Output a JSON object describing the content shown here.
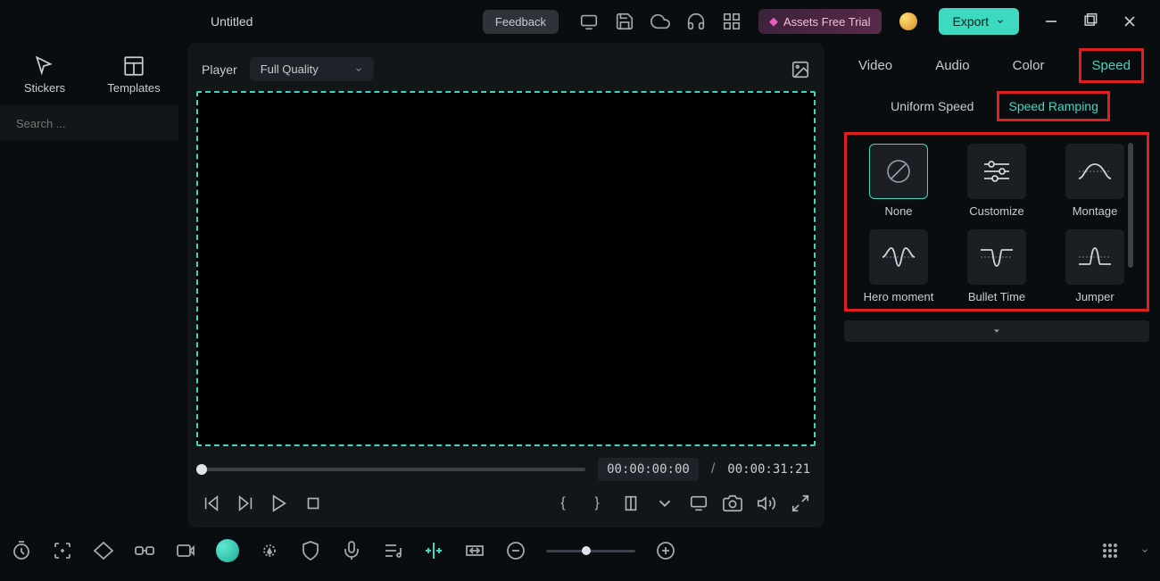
{
  "title": "Untitled",
  "topbar": {
    "feedback": "Feedback",
    "assets_trial": "Assets Free Trial",
    "export": "Export"
  },
  "sidebar": {
    "tabs": {
      "stickers": "Stickers",
      "templates": "Templates"
    },
    "search_placeholder": "Search ..."
  },
  "player": {
    "label": "Player",
    "quality": "Full Quality",
    "time_current": "00:00:00:00",
    "time_sep": "/",
    "time_total": "00:00:31:21"
  },
  "inspector": {
    "tabs": {
      "video": "Video",
      "audio": "Audio",
      "color": "Color",
      "speed": "Speed"
    },
    "speed_modes": {
      "uniform": "Uniform Speed",
      "ramping": "Speed Ramping"
    },
    "presets": {
      "none": "None",
      "customize": "Customize",
      "montage": "Montage",
      "hero": "Hero moment",
      "bullet": "Bullet Time",
      "jumper": "Jumper"
    }
  }
}
